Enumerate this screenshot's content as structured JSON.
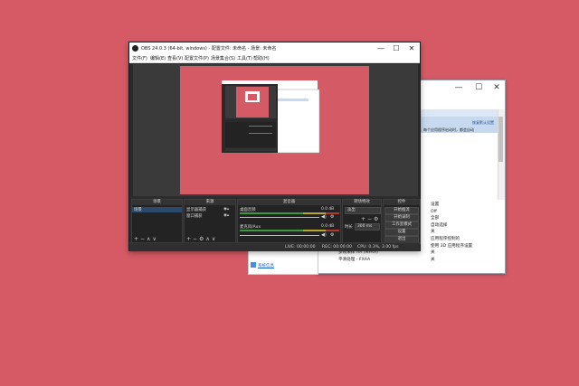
{
  "background_window": {
    "restore_link": "恢复默认设置",
    "description": "路。每个应用程序启动时，都会自动",
    "rows": [
      {
        "k": "",
        "v": "设置"
      },
      {
        "k": "",
        "v": "Off"
      },
      {
        "k": "",
        "v": "全部"
      },
      {
        "k": "",
        "v": "自动选择"
      },
      {
        "k": "",
        "v": "关"
      },
      {
        "k": "",
        "v": "应用程序控制的"
      },
      {
        "k": "",
        "v": "使用 3D 应用程序设置"
      },
      {
        "k": "多帧采样 AA (MFAA)",
        "v": "关"
      },
      {
        "k": "平滑处理 - FXAA",
        "v": "关"
      }
    ],
    "system_info": "系统信息"
  },
  "obs": {
    "title": "OBS 24.0.3 (64-bit, windows) - 配置文件: 未命名 - 场景: 未命名",
    "menu": [
      "文件(F)",
      "编辑(E)",
      "查看(V)",
      "配置文件(P)",
      "场景集合(S)",
      "工具(T)",
      "帮助(H)"
    ],
    "panels": {
      "scenes": {
        "title": "场景",
        "items": [
          "场景"
        ]
      },
      "sources": {
        "title": "来源",
        "items": [
          "显示器捕获",
          "窗口捕获"
        ]
      },
      "mixer": {
        "title": "混音器",
        "tracks": [
          {
            "name": "桌面音频",
            "db": "0.0 dB"
          },
          {
            "name": "麦克风/Aux",
            "db": "0.0 dB"
          }
        ]
      },
      "transitions": {
        "title": "转场特效",
        "type": "淡出",
        "duration_label": "时长",
        "duration": "300 ms"
      },
      "controls": {
        "title": "控件",
        "buttons": [
          "开始推流",
          "开始录制",
          "工作室模式",
          "设置",
          "退出"
        ]
      }
    },
    "status": {
      "live": "LIVE: 00:00:00",
      "rec": "REC: 00:00:00",
      "cpu": "CPU: 0.3%, 3.00 fps"
    }
  },
  "colors": {
    "desktop": "#d65a66",
    "obs_dark": "#292929",
    "meter_green": "#3c9a3c",
    "meter_yellow": "#b5a82a",
    "meter_red": "#b03a2e"
  }
}
